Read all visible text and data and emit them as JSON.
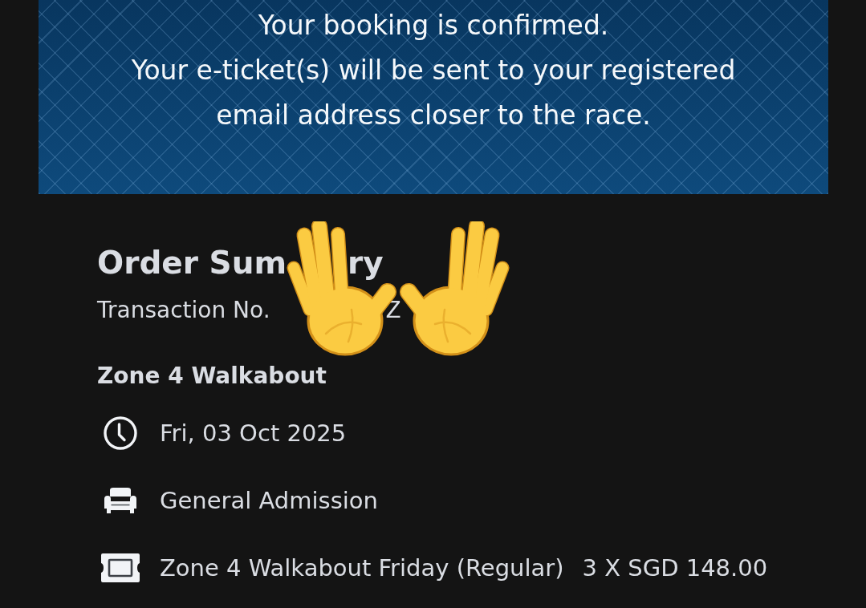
{
  "banner": {
    "headline": "Your booking is confirmed.",
    "message": "Your e-ticket(s) will be sent to your registered email address closer to the race."
  },
  "order_summary": {
    "title_parts": [
      "Order Sum",
      "ry"
    ],
    "transaction_parts": [
      "Transaction No.",
      "Z"
    ],
    "event": "Zone 4 Walkabout",
    "details": [
      {
        "kind": "date",
        "text": "Fri, 03 Oct 2025"
      },
      {
        "kind": "seating",
        "text": "General Admission"
      },
      {
        "kind": "ticket",
        "text": "Zone 4 Walkabout Friday (Regular)",
        "price": "3 X SGD 148.00"
      }
    ]
  }
}
